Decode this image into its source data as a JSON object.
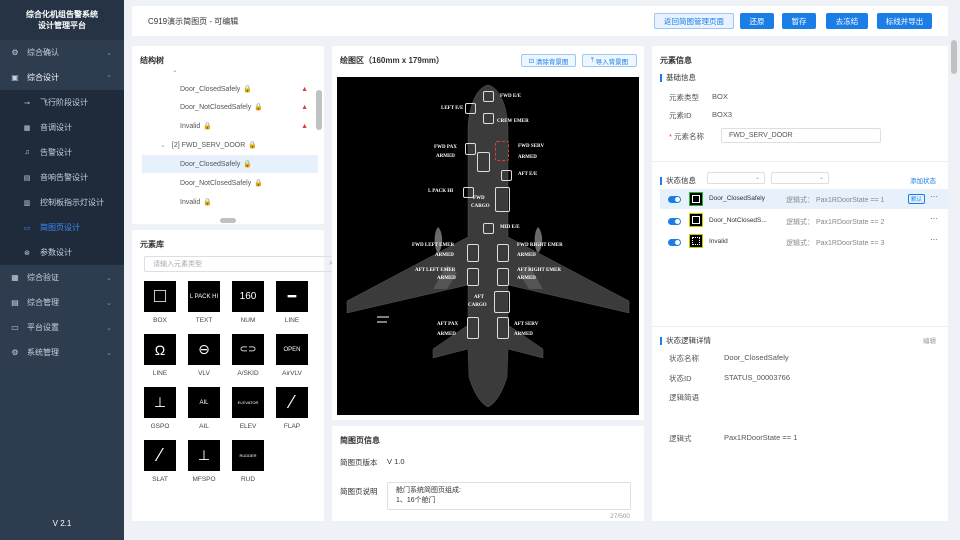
{
  "app": {
    "title_line1": "综合化机组告警系统",
    "title_line2": "设计管理平台",
    "version": "V 2.1"
  },
  "nav": {
    "groups": [
      {
        "label": "综合确认",
        "icon": "gear-icon"
      },
      {
        "label": "综合设计",
        "icon": "document-icon"
      },
      {
        "label": "综合验证",
        "icon": "grid-icon"
      },
      {
        "label": "综合管理",
        "icon": "briefcase-icon"
      },
      {
        "label": "平台设置",
        "icon": "monitor-icon"
      },
      {
        "label": "系统管理",
        "icon": "gear-icon"
      }
    ],
    "sub_items": [
      "飞行阶段设计",
      "音调设计",
      "告警设计",
      "音响告警设计",
      "控制板指示灯设计",
      "简图页设计",
      "参数设计"
    ]
  },
  "topbar": {
    "title": "C919演示简图页 - 可编辑",
    "btn_return": "返回简图管理页面",
    "btn_restore": "还原",
    "btn_save": "暂存",
    "btn_freeze": "去冻结",
    "btn_export": "标线并导出"
  },
  "tree": {
    "title": "结构树",
    "rows": [
      {
        "label": "Door_ClosedSafely",
        "lock": "🔒",
        "warn": "▲"
      },
      {
        "label": "Door_NotClosedSafely",
        "lock": "🔒",
        "warn": "▲"
      },
      {
        "label": "Invalid",
        "lock": "🔒",
        "warn": "▲"
      },
      {
        "label": "[2]  FWD_SERV_DOOR",
        "lock": "🔒",
        "warn": ""
      },
      {
        "label": "Door_ClosedSafely",
        "lock": "🔒",
        "warn": ""
      },
      {
        "label": "Door_NotClosedSafely",
        "lock": "🔒",
        "warn": ""
      },
      {
        "label": "Invalid",
        "lock": "🔒",
        "warn": ""
      }
    ]
  },
  "elements": {
    "title": "元素库",
    "search_placeholder": "请输入元素类型",
    "items": [
      {
        "label": "BOX",
        "glyph": "□"
      },
      {
        "label": "TEXT",
        "glyph": "L PACK HI"
      },
      {
        "label": "NUM",
        "glyph": "160"
      },
      {
        "label": "LINE",
        "glyph": "━"
      },
      {
        "label": "LINE",
        "glyph": "Ω"
      },
      {
        "label": "VLV",
        "glyph": "⊖"
      },
      {
        "label": "A/SKID",
        "glyph": "⊂⊃"
      },
      {
        "label": "AirVLV",
        "glyph": "OPEN"
      },
      {
        "label": "GSPO",
        "glyph": "⊥"
      },
      {
        "label": "AIL",
        "glyph": "AIL"
      },
      {
        "label": "ELEV",
        "glyph": "ELEVATOR"
      },
      {
        "label": "FLAP",
        "glyph": "⁄"
      },
      {
        "label": "SLAT",
        "glyph": "⁄"
      },
      {
        "label": "MFSPO",
        "glyph": "⊥"
      },
      {
        "label": "RUD",
        "glyph": "RUDDER"
      }
    ]
  },
  "drawing": {
    "title": "绘图区（160mm x 179mm）",
    "btn_clear": "清除背景图",
    "btn_import": "导入背景图",
    "labels": [
      "FWD E/E",
      "LEFT E/E",
      "CREW EMER",
      "FWD PAX",
      "ARMED",
      "FWD SERV",
      "ARMED",
      "AFT E/E",
      "L PACK HI",
      "FWD",
      "CARGO",
      "MID E/E",
      "FWD LEFT EMER",
      "ARMED",
      "FWD RIGHT EMER",
      "ARMED",
      "AFT LEFT EMER",
      "ARMED",
      "AFT RIGHT EMER",
      "ARMED",
      "AFT",
      "CARGO",
      "AFT PAX",
      "ARMED",
      "AFT SERV",
      "ARMED"
    ]
  },
  "page_info": {
    "title": "简图页信息",
    "version_label": "简图页版本",
    "version_value": "V 1.0",
    "desc_label": "简图页说明",
    "desc_line1": "舱门系统简图页组成:",
    "desc_line2": "1、16个舱门",
    "counter": "27/500"
  },
  "props": {
    "title": "元素信息",
    "basic_title": "基础信息",
    "type_label": "元素类型",
    "type_value": "BOX",
    "id_label": "元素ID",
    "id_value": "BOX3",
    "name_label": "元素名称",
    "name_value": "FWD_SERV_DOOR",
    "state_title": "状态信息",
    "add_state": "添加状态",
    "states": [
      {
        "name": "Door_ClosedSafely",
        "logic": "逻辑式：  Pax1RDoorState == 1",
        "badge": "默认"
      },
      {
        "name": "Door_NotClosedS...",
        "logic": "逻辑式：  Pax1RDoorState == 2",
        "badge": ""
      },
      {
        "name": "Invalid",
        "logic": "逻辑式：  Pax1RDoorState == 3",
        "badge": ""
      }
    ],
    "detail_title": "状态逻辑详情",
    "edit": "编辑",
    "state_name_label": "状态名称",
    "state_name_value": "Door_ClosedSafely",
    "state_id_label": "状态ID",
    "state_id_value": "STATUS_00003766",
    "logic_desc_label": "逻辑简语",
    "logic_label": "逻辑式",
    "logic_value": "Pax1RDoorState == 1"
  }
}
